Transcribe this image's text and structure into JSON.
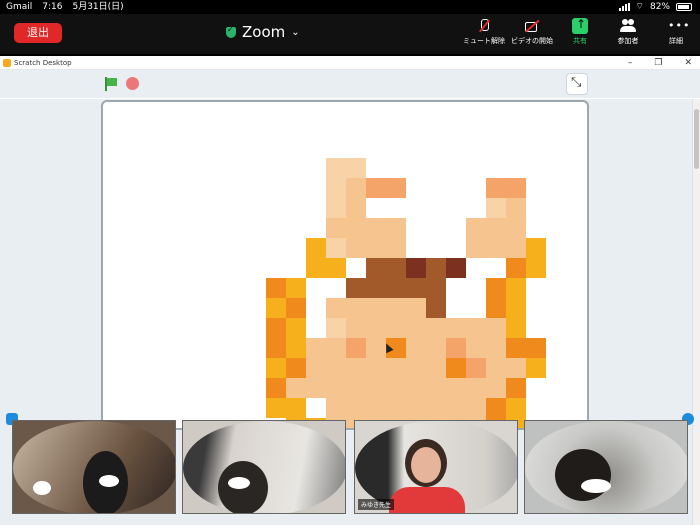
{
  "status_bar": {
    "app": "Gmail",
    "time": "7:16",
    "date": "5月31日(日)",
    "battery": "82%"
  },
  "zoom": {
    "leave_label": "退出",
    "title": "Zoom",
    "tools": [
      {
        "id": "unmute",
        "label": "ミュート解除",
        "icon": "mic-muted-icon"
      },
      {
        "id": "video",
        "label": "ビデオの開始",
        "icon": "video-off-icon"
      },
      {
        "id": "share",
        "label": "共有",
        "icon": "share-icon"
      },
      {
        "id": "participants",
        "label": "参加者",
        "icon": "participants-icon"
      },
      {
        "id": "more",
        "label": "詳細",
        "icon": "more-icon"
      }
    ],
    "accent": "#2bd06b",
    "leave_color": "#e02828"
  },
  "scratch": {
    "window_title": "Scratch Desktop",
    "controls": [
      "–",
      "❐",
      "✕"
    ]
  },
  "participants": [
    {
      "name": ""
    },
    {
      "name": ""
    },
    {
      "name": "みゆき先生"
    },
    {
      "name": ""
    }
  ]
}
